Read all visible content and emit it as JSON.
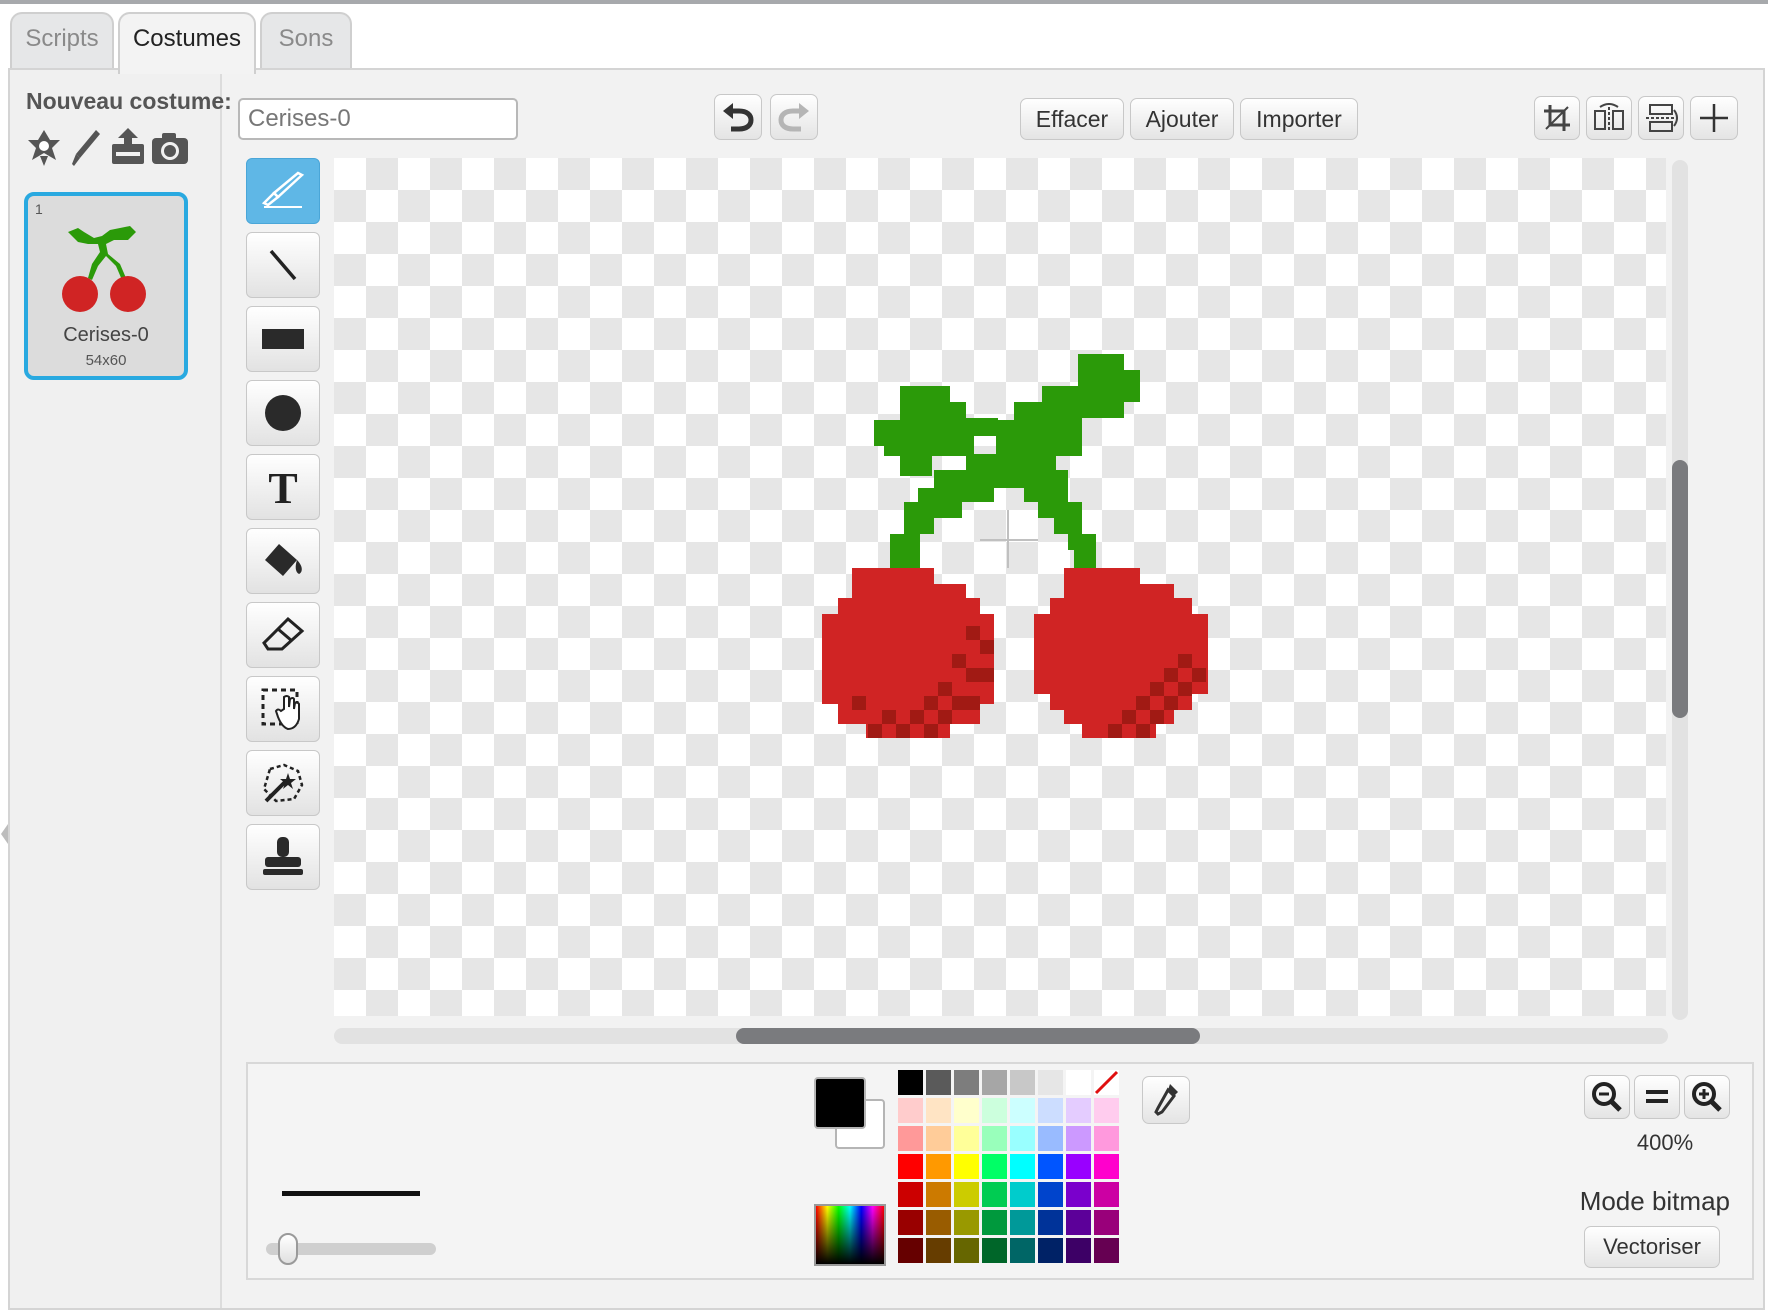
{
  "tabs": [
    {
      "label": "Scripts",
      "active": false
    },
    {
      "label": "Costumes",
      "active": true
    },
    {
      "label": "Sons",
      "active": false
    }
  ],
  "new_costume": {
    "label": "Nouveau costume:",
    "icons": [
      "sprite-library-icon",
      "paint-brush-icon",
      "upload-icon",
      "camera-icon"
    ]
  },
  "costumes": [
    {
      "number": "1",
      "name": "Cerises-0",
      "size": "54x60",
      "selected": true
    }
  ],
  "editor": {
    "costume_name": "Cerises-0",
    "buttons": {
      "clear": "Effacer",
      "add": "Ajouter",
      "import": "Importer"
    },
    "tools": [
      "paintbrush",
      "line",
      "rectangle",
      "ellipse",
      "text",
      "fill",
      "eraser",
      "select",
      "magic-select",
      "stamp"
    ],
    "selected_tool": "paintbrush"
  },
  "colors": {
    "leaf": "#2b9a09",
    "cherry": "#d02424",
    "cherry_shade": "#a11a14",
    "selection": "#29a9e0",
    "selected_tool": "#5fb7e6",
    "primary": "#000000",
    "secondary": "#ffffff"
  },
  "palette": [
    [
      "#000000",
      "#5a5a5a",
      "#7d7d7d",
      "#a6a6a6",
      "#c8c8c8",
      "#e6e6e6",
      "#ffffff",
      "none"
    ],
    [
      "#ffcccc",
      "#ffe4c4",
      "#ffffcc",
      "#ccffdd",
      "#ccffff",
      "#ccddff",
      "#e4ccff",
      "#ffccee"
    ],
    [
      "#ff9999",
      "#ffcc99",
      "#ffff99",
      "#99ffbb",
      "#99ffff",
      "#99bbff",
      "#cc99ff",
      "#ff99dd"
    ],
    [
      "#ff0000",
      "#ff9900",
      "#ffff00",
      "#00ff66",
      "#00ffff",
      "#0055ff",
      "#9900ff",
      "#ff00cc"
    ],
    [
      "#cc0000",
      "#cc7a00",
      "#cccc00",
      "#00cc52",
      "#00cccc",
      "#0044cc",
      "#7a00cc",
      "#cc00a3"
    ],
    [
      "#990000",
      "#995c00",
      "#999900",
      "#00993d",
      "#009999",
      "#003399",
      "#5c0099",
      "#99007a"
    ],
    [
      "#660000",
      "#663d00",
      "#666600",
      "#006629",
      "#006666",
      "#002266",
      "#3d0066",
      "#660052"
    ]
  ],
  "zoom": {
    "level": "400%"
  },
  "mode": {
    "label": "Mode bitmap",
    "convert_button": "Vectoriser"
  },
  "stroke_width": 0.13
}
